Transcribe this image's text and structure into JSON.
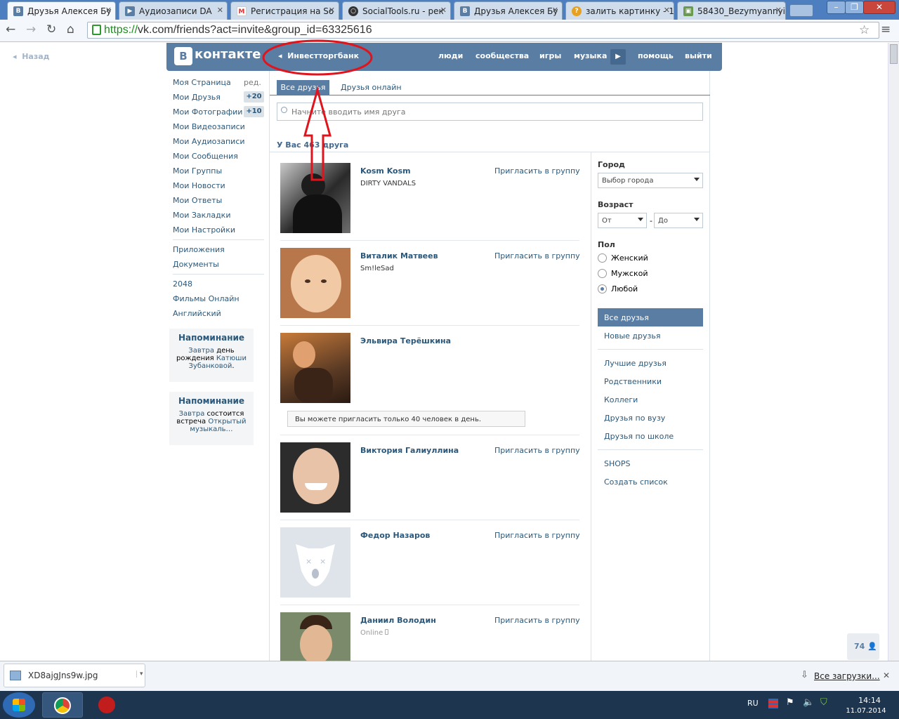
{
  "browser": {
    "tabs": [
      {
        "label": "Друзья Алексея Бу",
        "favicon": "vk"
      },
      {
        "label": "Аудиозаписи DA",
        "favicon": "vk-audio"
      },
      {
        "label": "Регистрация на So",
        "favicon": "gmail"
      },
      {
        "label": "SocialTools.ru - рек",
        "favicon": "socialtools"
      },
      {
        "label": "Друзья Алексея Бу",
        "favicon": "vk"
      },
      {
        "label": "залить картинку - 1",
        "favicon": "search"
      },
      {
        "label": "58430_Bezymyannyi",
        "favicon": "image"
      }
    ],
    "url_scheme": "https://",
    "url_rest": "vk.com/friends?act=invite&group_id=63325616"
  },
  "vk": {
    "back": "Назад",
    "logo_letter": "В",
    "logo_text": "контакте",
    "group": "Инвестторгбанк",
    "nav": [
      "люди",
      "сообщества",
      "игры",
      "музыка",
      "помощь",
      "выйти"
    ],
    "menu": [
      {
        "label": "Моя Страница",
        "extra": "ред."
      },
      {
        "label": "Мои Друзья",
        "count": "+20"
      },
      {
        "label": "Мои Фотографии",
        "count": "+10"
      },
      {
        "label": "Мои Видеозаписи"
      },
      {
        "label": "Мои Аудиозаписи"
      },
      {
        "label": "Мои Сообщения"
      },
      {
        "label": "Мои Группы"
      },
      {
        "label": "Мои Новости"
      },
      {
        "label": "Мои Ответы"
      },
      {
        "label": "Мои Закладки"
      },
      {
        "label": "Мои Настройки"
      }
    ],
    "menu2": [
      "Приложения",
      "Документы"
    ],
    "menu3": [
      "2048",
      "Фильмы Онлайн",
      "Английский"
    ],
    "reminders": [
      {
        "title": "Напоминание",
        "a": "Завтра",
        "b": " день рождения ",
        "c": "Катюши Зубанковой",
        "d": "."
      },
      {
        "title": "Напоминание",
        "a": "Завтра",
        "b": " состоится встреча ",
        "c": "Открытый музыкаль…",
        "d": ""
      }
    ],
    "tabs": {
      "all": "Все друзья",
      "online": "Друзья онлайн"
    },
    "search_placeholder": "Начните вводить имя друга",
    "count_text": "У Вас 463 друга",
    "invite_label": "Пригласить в группу",
    "friends": [
      {
        "name": "Kosm Kosm",
        "sub": "DIRTY VANDALS",
        "invite": true
      },
      {
        "name": "Виталик Матвеев",
        "sub": "Sm!leSad",
        "invite": true
      },
      {
        "name": "Эльвира Терёшкина",
        "sub": "",
        "invite": false
      },
      {
        "name": "Виктория Галиуллина",
        "sub": "",
        "invite": true
      },
      {
        "name": "Федор Назаров",
        "sub": "",
        "invite": true
      },
      {
        "name": "Даниил Володин",
        "sub": "Online",
        "invite": true
      }
    ],
    "limit_message": "Вы можете пригласить только 40 человек в день.",
    "filters": {
      "city_label": "Город",
      "city_value": "Выбор города",
      "age_label": "Возраст",
      "age_from": "От",
      "age_to": "До",
      "age_dash": "-",
      "sex_label": "Пол",
      "sex_options": [
        "Женский",
        "Мужской",
        "Любой"
      ],
      "sex_selected": 2,
      "lists_active": "Все друзья",
      "lists": [
        "Новые друзья"
      ],
      "lists2": [
        "Лучшие друзья",
        "Родственники",
        "Коллеги",
        "Друзья по вузу",
        "Друзья по школе"
      ],
      "lists3": [
        "SHOPS",
        "Создать список"
      ]
    },
    "online_counter": "74"
  },
  "downloads": {
    "file": "XD8ajgJns9w.jpg",
    "all": "Все загрузки..."
  },
  "taskbar": {
    "lang": "RU",
    "time": "14:14",
    "date": "11.07.2014"
  },
  "colors": {
    "vk_blue": "#597da3",
    "link": "#2b587a",
    "annotation_red": "#e0141c"
  }
}
